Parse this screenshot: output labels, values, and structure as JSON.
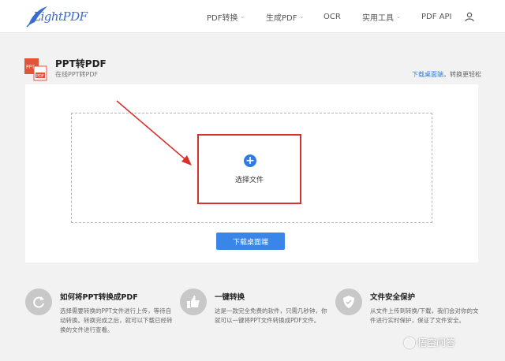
{
  "header": {
    "logo_text": "LightPDF",
    "nav": [
      {
        "label": "PDF转换",
        "has_dropdown": true
      },
      {
        "label": "生成PDF",
        "has_dropdown": true
      },
      {
        "label": "OCR",
        "has_dropdown": false
      },
      {
        "label": "实用工具",
        "has_dropdown": true
      },
      {
        "label": "PDF API",
        "has_dropdown": false
      }
    ],
    "chevron": "⌄"
  },
  "page": {
    "title": "PPT转PDF",
    "subtitle": "在线PPT转PDF",
    "top_link": "下载桌面端",
    "top_link_suffix": "，转换更轻松",
    "ppt_icon_labels": {
      "top": "PPT",
      "bottom": "PDF"
    }
  },
  "upload": {
    "plus": "+",
    "label": "选择文件",
    "download_button": "下载桌面端"
  },
  "features": [
    {
      "icon": "refresh-icon",
      "title": "如何将PPT转换成PDF",
      "desc": "选择需要转换的PPT文件进行上传，等待自动转换。转换完成之后，就可以下载已经转换的文件进行查看。"
    },
    {
      "icon": "thumbs-up-icon",
      "title": "一键转换",
      "desc": "这是一款完全免费的软件，只需几秒钟，你就可以一键将PPT文件转换成PDF文件。"
    },
    {
      "icon": "shield-icon",
      "title": "文件安全保护",
      "desc": "从文件上传到转换/下载，我们会对你的文件进行实时保护，保证了文件安全。"
    }
  ],
  "watermark": "悟空问答",
  "colors": {
    "accent": "#3a86e8",
    "highlight": "#d9302c",
    "link": "#2f7ae5"
  }
}
